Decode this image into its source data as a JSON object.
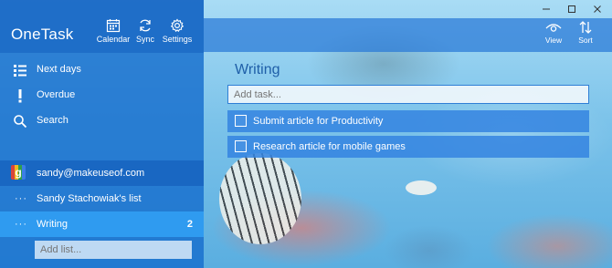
{
  "app": {
    "title": "OneTask"
  },
  "header_buttons": [
    {
      "label": "Calendar",
      "icon": "calendar-icon"
    },
    {
      "label": "Sync",
      "icon": "sync-icon"
    },
    {
      "label": "Settings",
      "icon": "gear-icon"
    }
  ],
  "sidebar": {
    "nav": [
      {
        "label": "Next days",
        "icon": "calendar-list-icon"
      },
      {
        "label": "Overdue",
        "icon": "exclamation-icon"
      },
      {
        "label": "Search",
        "icon": "search-icon"
      }
    ],
    "account": {
      "email": "sandy@makeuseof.com",
      "icon": "google-icon",
      "badge_letter": "g"
    },
    "lists": [
      {
        "dots": "···",
        "label": "Sandy Stachowiak's list",
        "count": ""
      },
      {
        "dots": "···",
        "label": "Writing",
        "count": "2",
        "selected": true
      }
    ],
    "add_list_placeholder": "Add list..."
  },
  "toolbar": {
    "view_label": "View",
    "sort_label": "Sort"
  },
  "main": {
    "list_title": "Writing",
    "add_task_placeholder": "Add task...",
    "tasks": [
      {
        "label": "Submit article for Productivity",
        "done": false
      },
      {
        "label": "Research article for mobile games",
        "done": false
      }
    ]
  },
  "colors": {
    "sidebar": "#166ecd",
    "selected_list": "#2f9bf0",
    "task_row": "#3484e0",
    "title_text": "#1f5fa8"
  }
}
